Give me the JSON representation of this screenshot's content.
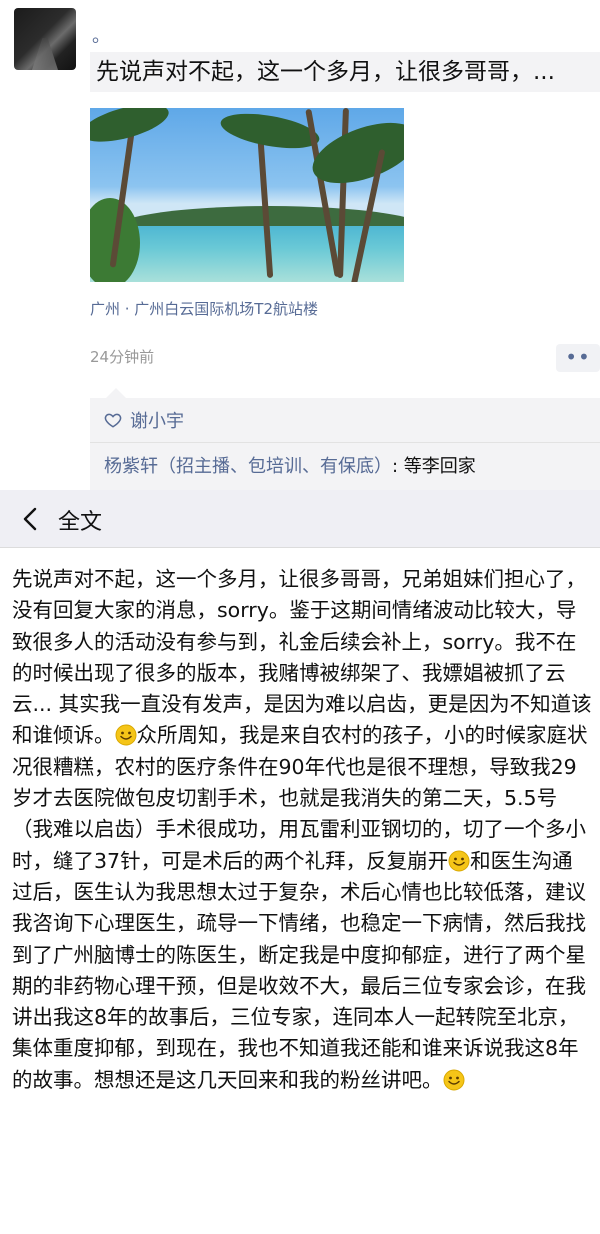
{
  "moment": {
    "author_name": "。",
    "text_preview": "先说声对不起，这一个多月，让很多哥哥，...",
    "location": "广州 · 广州白云国际机场T2航站楼",
    "time": "24分钟前",
    "more_label": "••",
    "likes": [
      "谢小宇"
    ],
    "comments": [
      {
        "author": "杨紫轩（招主播、包培训、有保底）",
        "text": ": 等李回家"
      }
    ]
  },
  "navbar": {
    "title": "全文"
  },
  "fulltext": {
    "p1": "先说声对不起，这一个多月，让很多哥哥，兄弟姐妹们担心了，没有回复大家的消息，sorry。鉴于这期间情绪波动比较大，导致很多人的活动没有参与到，礼金后续会补上，sorry。我不在的时候出现了很多的版本，我赌博被绑架了、我嫖娼被抓了云云... 其实我一直没有发声，是因为难以启齿，更是因为不知道该和谁倾诉。",
    "p2": "众所周知，我是来自农村的孩子，小的时候家庭状况很糟糕，农村的医疗条件在90年代也是很不理想，导致我29岁才去医院做包皮切割手术，也就是我消失的第二天，5.5号（我难以启齿）手术很成功，用瓦雷利亚钢切的，切了一个多小时，缝了37针，可是术后的两个礼拜，反复崩开",
    "p3": "和医生沟通过后，医生认为我思想太过于复杂，术后心情也比较低落，建议我咨询下心理医生，疏导一下情绪，也稳定一下病情，然后我找到了广州脑博士的陈医生，断定我是中度抑郁症，进行了两个星期的非药物心理干预，但是收效不大，最后三位专家会诊，在我讲出我这8年的故事后，三位专家，连同本人一起转院至北京，集体重度抑郁，到现在，我也不知道我还能和谁来诉说我这8年的故事。想想还是这几天回来和我的粉丝讲吧。"
  },
  "icons": {
    "heart": "heart-outline-icon",
    "back": "chevron-left-icon",
    "emoji": "smile-emoji-icon"
  },
  "colors": {
    "link": "#576b95",
    "bubble_bg": "#f3f3f5",
    "navbar_bg": "#efeff4",
    "emoji": "#f5c518"
  }
}
